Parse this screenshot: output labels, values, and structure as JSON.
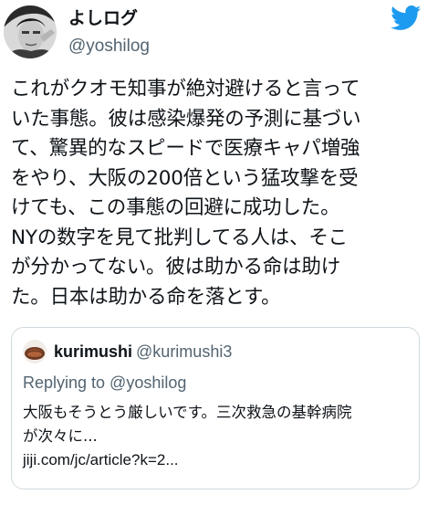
{
  "tweet": {
    "display_name": "よしログ",
    "username": "@yoshilog",
    "text_lines": [
      "これがクオモ知事が絶対避けると言って",
      "いた事態。彼は感染爆発の予測に基づい",
      "て、驚異的なスピードで医療キャパ増強",
      "をやり、大阪の200倍という猛攻撃を受",
      "けても、この事態の回避に成功した。",
      "NYの数字を見て批判してる人は、そこ",
      "が分かってない。彼は助かる命は助け",
      "た。日本は助かる命を落とす。"
    ]
  },
  "quote": {
    "display_name": "kurimushi",
    "username": "@kurimushi3",
    "replying_to": "Replying to @yoshilog",
    "text_lines": [
      "大阪もそうとう厳しいです。三次救急の基幹病院",
      "が次々に..."
    ],
    "link": "jiji.com/jc/article?k=2..."
  },
  "colors": {
    "twitter_blue": "#1d9bf0",
    "secondary_text": "#536471",
    "border": "#cfd9de"
  },
  "icons": {
    "brand": "twitter-bird-icon"
  }
}
